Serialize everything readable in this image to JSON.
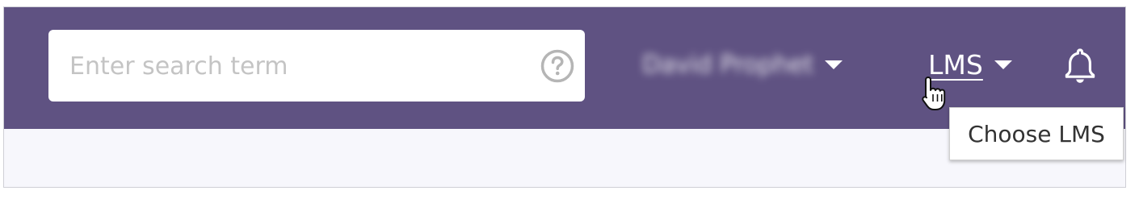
{
  "search": {
    "placeholder": "Enter search term",
    "value": "",
    "help_icon": "question-circle-icon"
  },
  "user_menu": {
    "name": "David Prophet",
    "name_blurred": true,
    "caret_icon": "caret-down-icon"
  },
  "lms_menu": {
    "label": "LMS",
    "caret_icon": "caret-down-icon",
    "tooltip": "Choose LMS"
  },
  "notifications": {
    "icon": "bell-icon"
  },
  "colors": {
    "topbar": "#5f5282",
    "content_bg": "#f7f7fc",
    "search_bg": "#ffffff",
    "placeholder": "#c4c4c4",
    "icon_gray": "#b5b5b5"
  }
}
